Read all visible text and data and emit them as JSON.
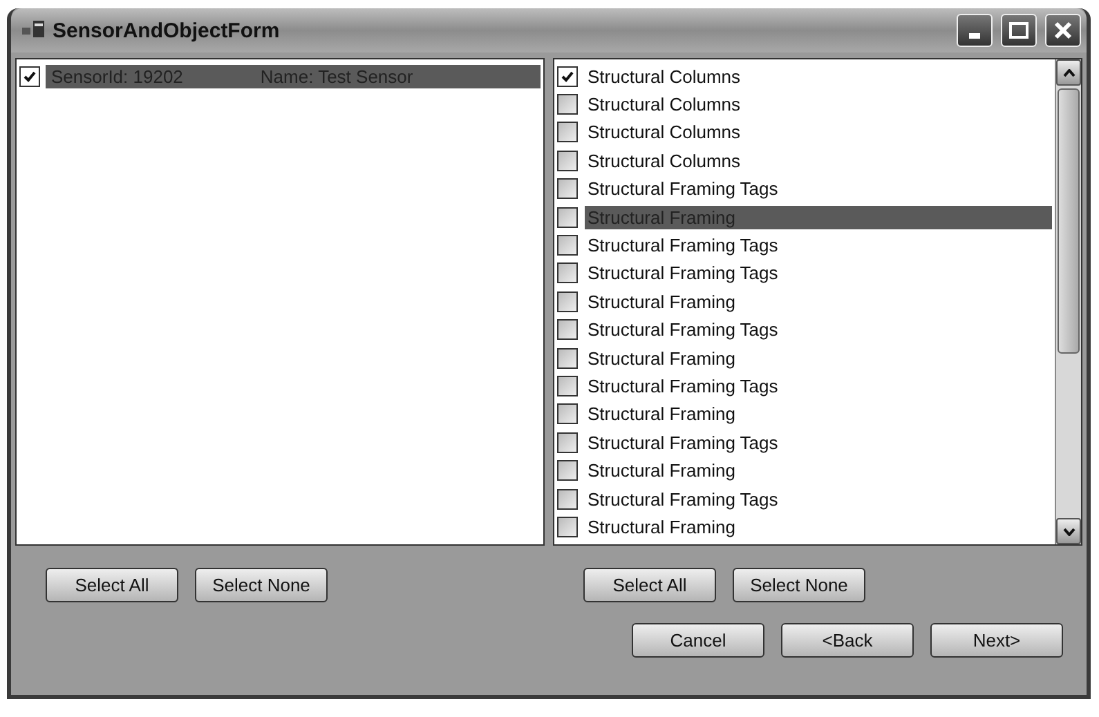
{
  "window": {
    "title": "SensorAndObjectForm"
  },
  "sensors": [
    {
      "id": "SensorId: 19202",
      "name": "Name: Test Sensor",
      "checked": true,
      "selected": true
    }
  ],
  "objects": [
    {
      "label": "Structural Columns",
      "checked": true,
      "selected": false
    },
    {
      "label": "Structural Columns",
      "checked": false,
      "selected": false
    },
    {
      "label": "Structural Columns",
      "checked": false,
      "selected": false
    },
    {
      "label": "Structural Columns",
      "checked": false,
      "selected": false
    },
    {
      "label": "Structural Framing Tags",
      "checked": false,
      "selected": false
    },
    {
      "label": "Structural Framing",
      "checked": false,
      "selected": true
    },
    {
      "label": "Structural Framing Tags",
      "checked": false,
      "selected": false
    },
    {
      "label": "Structural Framing Tags",
      "checked": false,
      "selected": false
    },
    {
      "label": "Structural Framing",
      "checked": false,
      "selected": false
    },
    {
      "label": "Structural Framing Tags",
      "checked": false,
      "selected": false
    },
    {
      "label": "Structural Framing",
      "checked": false,
      "selected": false
    },
    {
      "label": "Structural Framing Tags",
      "checked": false,
      "selected": false
    },
    {
      "label": "Structural Framing",
      "checked": false,
      "selected": false
    },
    {
      "label": "Structural Framing Tags",
      "checked": false,
      "selected": false
    },
    {
      "label": "Structural Framing",
      "checked": false,
      "selected": false
    },
    {
      "label": "Structural Framing Tags",
      "checked": false,
      "selected": false
    },
    {
      "label": "Structural Framing",
      "checked": false,
      "selected": false
    }
  ],
  "left_buttons": [
    "Select All",
    "Select None"
  ],
  "right_buttons": [
    "Select All",
    "Select None"
  ],
  "footer_buttons": [
    "Cancel",
    "<Back",
    "Next>"
  ]
}
